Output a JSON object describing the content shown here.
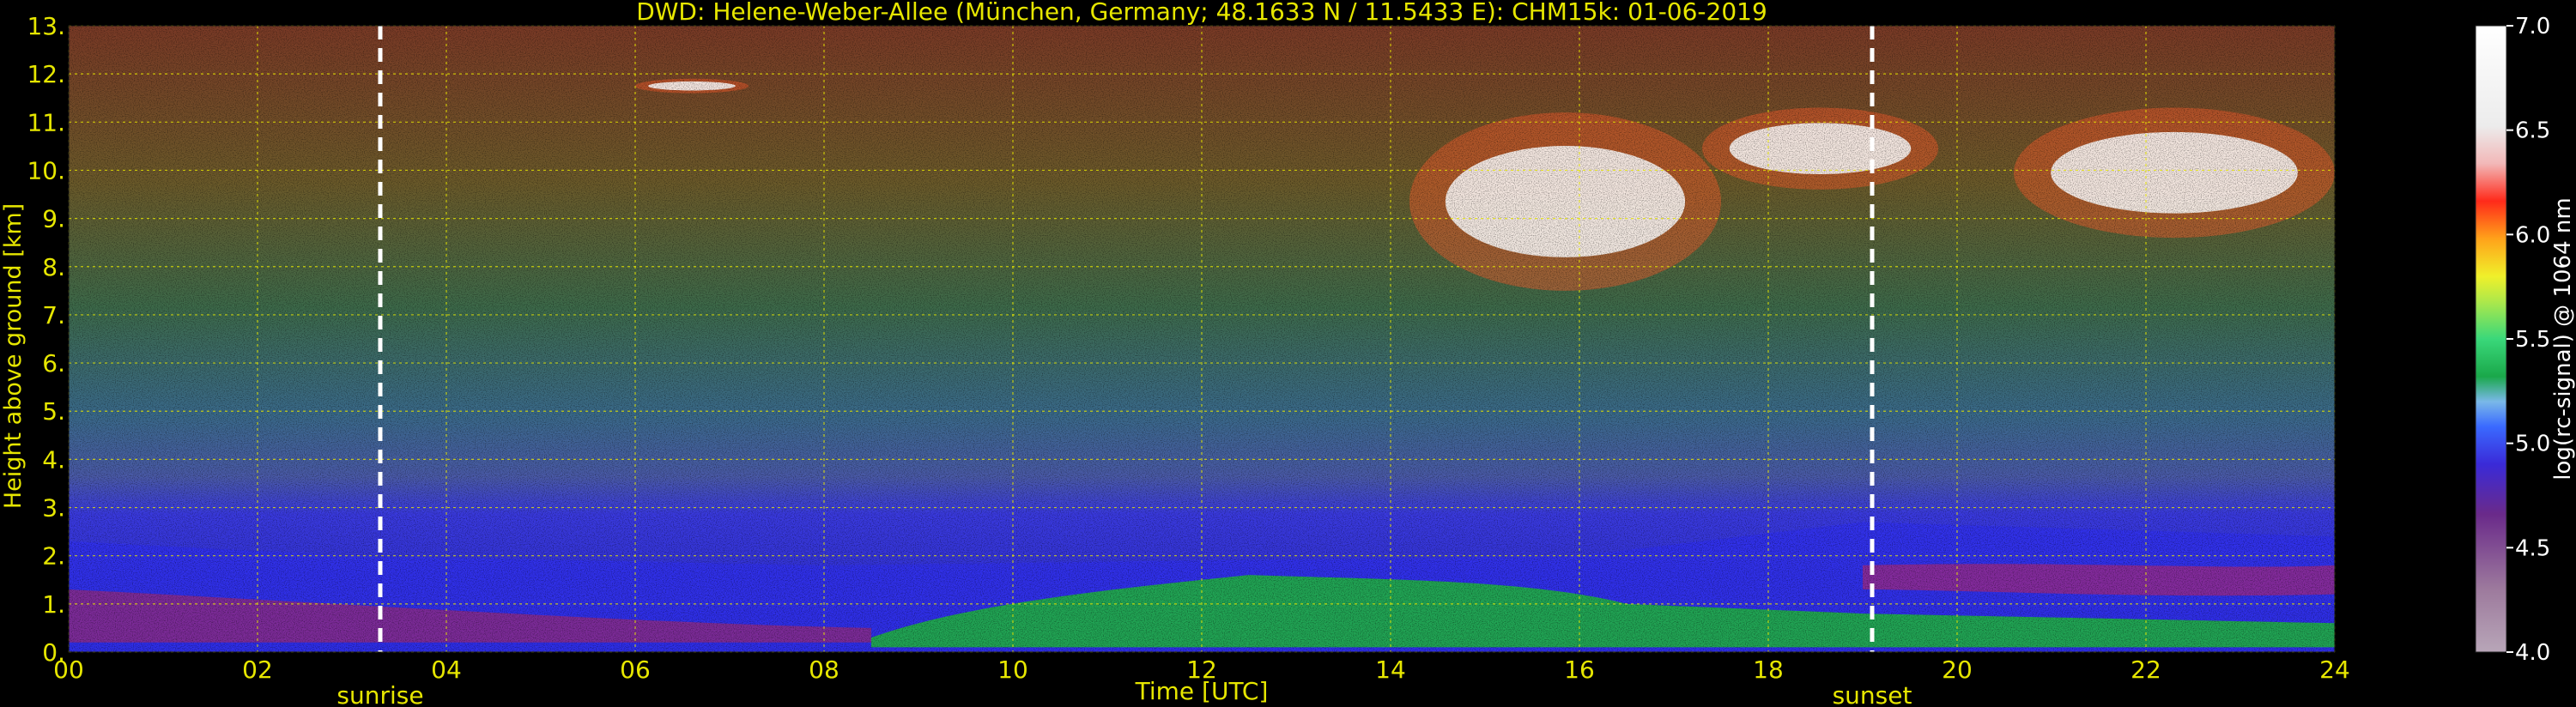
{
  "chart_data": {
    "type": "heatmap",
    "title": "DWD: Helene-Weber-Allee (München, Germany; 48.1633 N / 11.5433 E):    CHM15k: 01-06-2019",
    "xlabel": "Time [UTC]",
    "ylabel": "Height above ground [km]",
    "xlim": [
      0,
      24
    ],
    "ylim": [
      0,
      13
    ],
    "x_ticks": [
      0,
      2,
      4,
      6,
      8,
      10,
      12,
      14,
      16,
      18,
      20,
      22,
      24
    ],
    "x_tick_labels": [
      "00",
      "02",
      "04",
      "06",
      "08",
      "10",
      "12",
      "14",
      "16",
      "18",
      "20",
      "22",
      "24"
    ],
    "y_ticks": [
      0,
      1,
      2,
      3,
      4,
      5,
      6,
      7,
      8,
      9,
      10,
      11,
      12,
      13
    ],
    "y_tick_labels": [
      "0.",
      "1.",
      "2.",
      "3.",
      "4.",
      "5.",
      "6.",
      "7.",
      "8.",
      "9.",
      "10.",
      "11.",
      "12.",
      "13."
    ],
    "grid": true,
    "events": [
      {
        "label": "sunrise",
        "x": 3.3
      },
      {
        "label": "sunset",
        "x": 19.1
      }
    ],
    "colorbar": {
      "label": "log(rc-signal) @ 1064 nm",
      "range": [
        4.0,
        7.0
      ],
      "ticks": [
        "4.0",
        "4.5",
        "5.0",
        "5.5",
        "6.0",
        "6.5",
        "7.0"
      ]
    },
    "signal_features": {
      "boundary_layer_top_km": {
        "x": [
          0,
          3,
          8,
          12,
          16,
          19,
          24
        ],
        "y": [
          2.3,
          2.0,
          1.8,
          1.9,
          2.0,
          2.7,
          2.4
        ]
      },
      "convective_layer": {
        "x_range": [
          8.5,
          16.5
        ],
        "top_km": 1.6
      },
      "cirrus_clouds": [
        {
          "x": [
            6,
            7.2
          ],
          "y": [
            11.6,
            11.9
          ]
        },
        {
          "x": [
            14.2,
            17.5
          ],
          "y": [
            7.5,
            11.2
          ]
        },
        {
          "x": [
            17.3,
            19.8
          ],
          "y": [
            9.6,
            11.3
          ]
        },
        {
          "x": [
            20.6,
            24
          ],
          "y": [
            8.6,
            11.3
          ]
        }
      ]
    }
  }
}
